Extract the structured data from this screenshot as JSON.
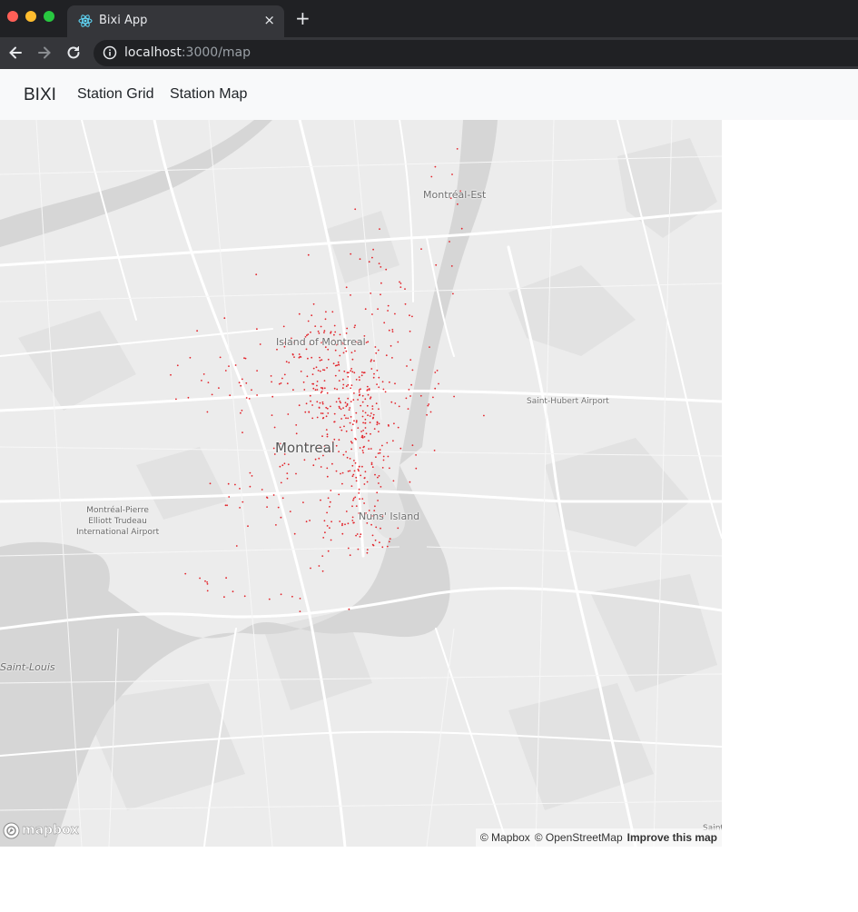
{
  "browser": {
    "tab_title": "Bixi App",
    "tab_close": "×",
    "new_tab": "+",
    "url_host": "localhost",
    "url_path": ":3000/map"
  },
  "navbar": {
    "brand": "BIXI",
    "links": [
      {
        "label": "Station Grid"
      },
      {
        "label": "Station Map"
      }
    ]
  },
  "map": {
    "labels": {
      "montreal_est": "Montréal-Est",
      "island": "Island of Montreal",
      "montreal": "Montreal",
      "saint_hubert": "Saint-Hubert Airport",
      "airport": "Montréal-Pierre\nElliott Trudeau\nInternational Airport",
      "nuns_island": "Nuns' Island",
      "saint_louis": "Saint-Louis",
      "saint_edge": "Saint"
    },
    "logo": "mapbox",
    "attribution": {
      "mapbox": "© Mapbox",
      "osm": "© OpenStreetMap",
      "improve": "Improve this map"
    },
    "station_color": "#e3242b",
    "water_color": "#d6d6d6",
    "land_color": "#ececec",
    "road_color": "#ffffff"
  }
}
